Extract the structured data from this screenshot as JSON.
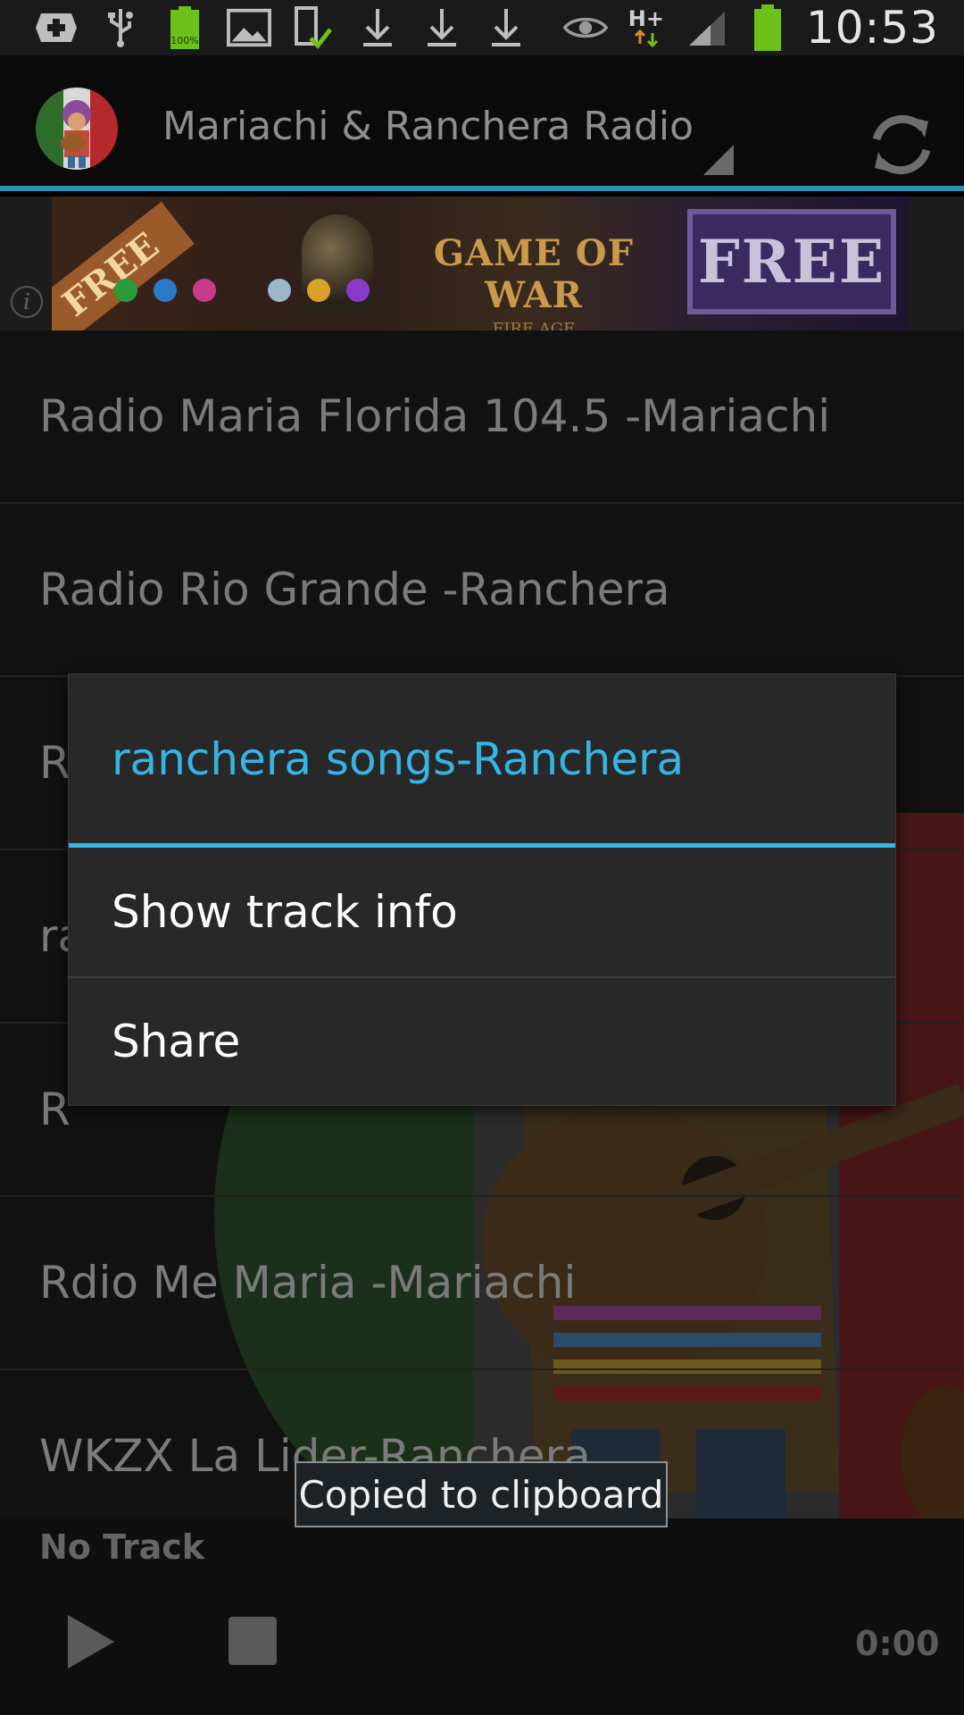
{
  "status_bar": {
    "time": "10:53",
    "icons": [
      "add-box-icon",
      "usb-icon",
      "battery-100-icon",
      "image-icon",
      "phone-check-icon",
      "download-icon",
      "download-icon",
      "download-icon",
      "eye-icon",
      "hplus-signal-icon",
      "signal-icon",
      "battery-icon"
    ],
    "battery_label": "100%",
    "network_label": "H+"
  },
  "action_bar": {
    "title": "Mariachi & Ranchera Radio",
    "refresh_icon": "refresh-icon",
    "accent_color": "#2f8fb3"
  },
  "ad": {
    "free_left": "FREE",
    "game_title": "GAME OF WAR",
    "game_subtitle": "FIRE AGE",
    "free_right": "FREE",
    "info_icon": "info-icon"
  },
  "stations": [
    {
      "label": "Radio Maria Florida 104.5 -Mariachi"
    },
    {
      "label": "Radio Rio Grande -Ranchera"
    },
    {
      "label": "R"
    },
    {
      "label": "ra"
    },
    {
      "label": "R"
    },
    {
      "label": "Rdio Me Maria -Mariachi"
    },
    {
      "label": "WKZX La Lider-Ranchera"
    }
  ],
  "player": {
    "now_playing": "No Track",
    "time": "0:00"
  },
  "dialog": {
    "title": "ranchera songs-Ranchera",
    "items": [
      {
        "label": "Show track info"
      },
      {
        "label": "Share"
      }
    ],
    "title_color": "#36b4e4"
  },
  "toast": {
    "text": "Copied to clipboard"
  }
}
